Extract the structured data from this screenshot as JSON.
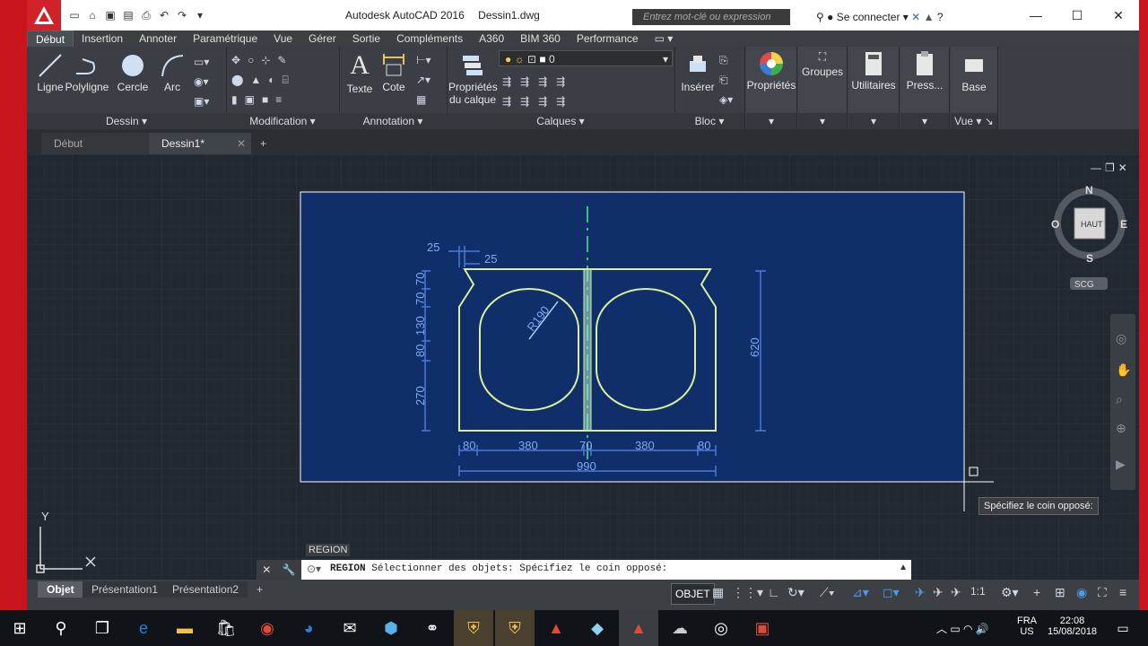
{
  "titlebar": {
    "app_name": "Autodesk AutoCAD 2016",
    "file_name": "Dessin1.dwg",
    "search_placeholder": "Entrez mot-clé ou expression",
    "signin_label": "Se connecter"
  },
  "ribbon_tabs": [
    "Début",
    "Insertion",
    "Annoter",
    "Paramétrique",
    "Vue",
    "Gérer",
    "Sortie",
    "Compléments",
    "A360",
    "BIM 360",
    "Performance"
  ],
  "ribbon": {
    "dessin": {
      "title": "Dessin",
      "tools": [
        "Ligne",
        "Polyligne",
        "Cercle",
        "Arc"
      ]
    },
    "modification": {
      "title": "Modification"
    },
    "annotation": {
      "title": "Annotation",
      "tools": [
        "Texte",
        "Cote"
      ]
    },
    "calques": {
      "title": "Calques",
      "layer_props": "Propriétés du calque",
      "current_layer": "0"
    },
    "bloc": {
      "title": "Bloc",
      "insert": "Insérer"
    },
    "proprietes": {
      "label": "Propriétés"
    },
    "groupes": {
      "label": "Groupes"
    },
    "utilitaires": {
      "label": "Utilitaires"
    },
    "presse": {
      "label": "Press..."
    },
    "base": {
      "label": "Base"
    },
    "vue": {
      "title": "Vue"
    }
  },
  "doc_tabs": {
    "start": "Début",
    "current": "Dessin1*"
  },
  "viewcube": {
    "n": "N",
    "s": "S",
    "e": "E",
    "o": "O",
    "top": "HAUT",
    "ucs": "SCG"
  },
  "drawing": {
    "dims": {
      "d25a": "25",
      "d25b": "25",
      "d70a": "70",
      "d70b": "70",
      "d130": "130",
      "d80": "80",
      "d270": "270",
      "r190": "R190",
      "d620": "620",
      "b80a": "80",
      "b380a": "380",
      "b70": "70",
      "b380b": "380",
      "b80b": "80",
      "d990": "990"
    },
    "ucs_x": "X",
    "ucs_y": "Y"
  },
  "tooltip": "Spécifiez le coin opposé:",
  "region_tip": "REGION",
  "command": {
    "name": "REGION",
    "text": "Sélectionner des objets: Spécifiez le coin opposé:"
  },
  "layout_tabs": [
    "Objet",
    "Présentation1",
    "Présentation2"
  ],
  "status": {
    "model": "OBJET",
    "scale": "1:1"
  },
  "tray": {
    "lang": "FRA",
    "lang2": "US",
    "time": "22:08",
    "date": "15/08/2018"
  }
}
